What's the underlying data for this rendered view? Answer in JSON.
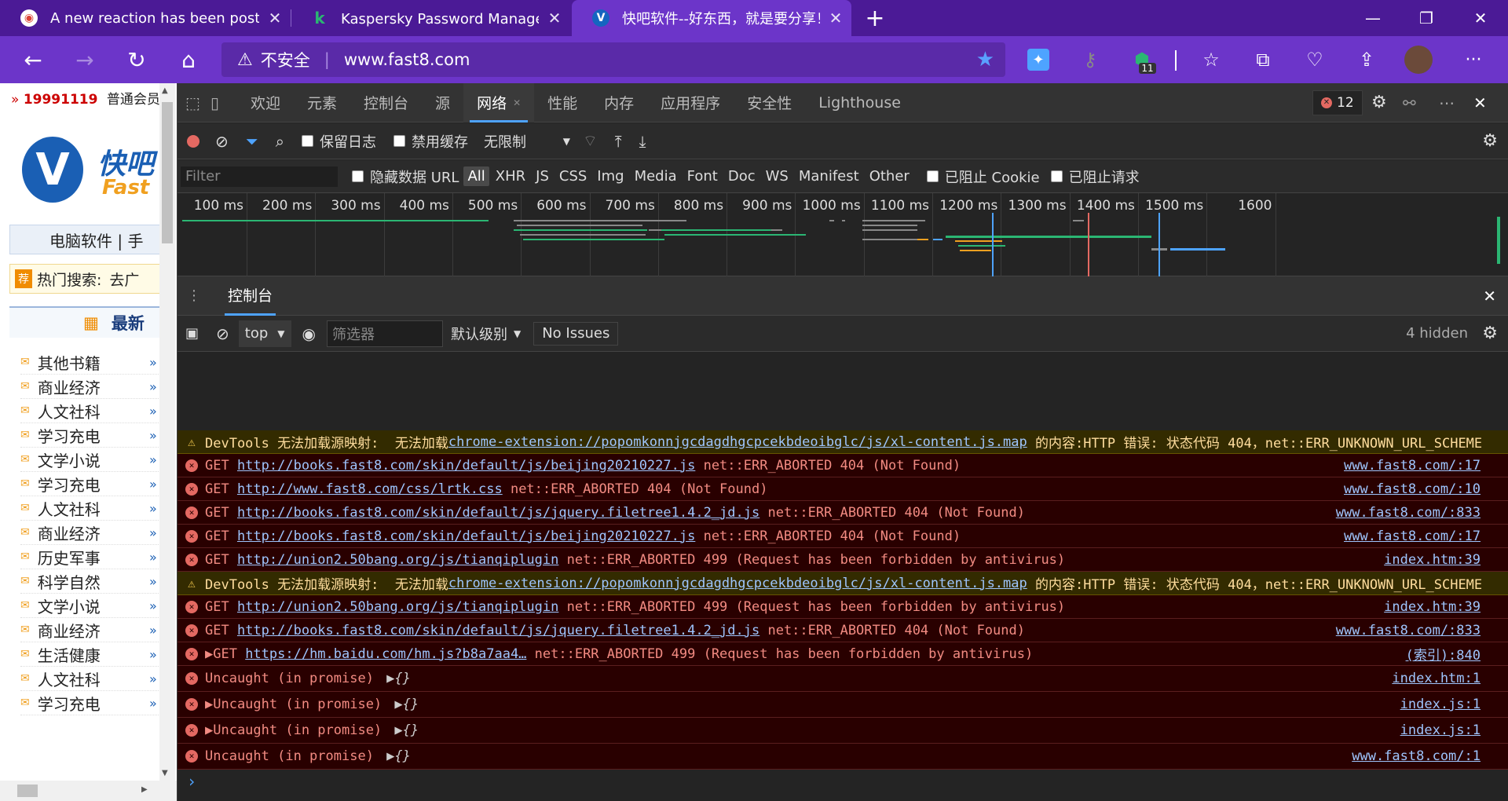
{
  "tabs": [
    {
      "title": "A new reaction has been posted",
      "icon": "chrome-icon"
    },
    {
      "title": "Kaspersky Password Manager自动",
      "icon": "kaspersky-icon"
    },
    {
      "title": "快吧软件--好东西，就是要分享！",
      "icon": "fast8-icon"
    }
  ],
  "address": {
    "security_label": "不安全",
    "url": "www.fast8.com",
    "ext_badge": "11"
  },
  "page": {
    "user_id": "19991119",
    "user_level": "普通会员",
    "logo_text_1": "快吧",
    "logo_text_2": "Fast",
    "nav_text": "电脑软件 | 手",
    "hot_label": "热门搜索:",
    "hot_value": "去广",
    "section_title": "最新",
    "categories": [
      "其他书籍",
      "商业经济",
      "人文社科",
      "学习充电",
      "文学小说",
      "学习充电",
      "人文社科",
      "商业经济",
      "历史军事",
      "科学自然",
      "文学小说",
      "商业经济",
      "生活健康",
      "人文社科",
      "学习充电"
    ]
  },
  "devtools": {
    "tabs": [
      "欢迎",
      "元素",
      "控制台",
      "源",
      "网络",
      "性能",
      "内存",
      "应用程序",
      "安全性",
      "Lighthouse"
    ],
    "selected_tab": "网络",
    "error_count": "12",
    "network": {
      "preserve_log": "保留日志",
      "disable_cache": "禁用缓存",
      "throttle": "无限制",
      "filter_placeholder": "Filter",
      "hide_data_urls": "隐藏数据 URL",
      "type_filters": [
        "All",
        "XHR",
        "JS",
        "CSS",
        "Img",
        "Media",
        "Font",
        "Doc",
        "WS",
        "Manifest",
        "Other"
      ],
      "blocked_cookies": "已阻止 Cookie",
      "blocked_requests": "已阻止请求",
      "ticks": [
        "100 ms",
        "200 ms",
        "300 ms",
        "400 ms",
        "500 ms",
        "600 ms",
        "700 ms",
        "800 ms",
        "900 ms",
        "1000 ms",
        "1100 ms",
        "1200 ms",
        "1300 ms",
        "1400 ms",
        "1500 ms",
        "1600"
      ]
    },
    "drawer_tab": "控制台",
    "console": {
      "context": "top",
      "filter_placeholder": "筛选器",
      "level": "默认级别",
      "issues": "No Issues",
      "hidden": "4 hidden",
      "messages": [
        {
          "type": "warn",
          "pre": "DevTools 无法加载源映射:  无法加载",
          "link": "chrome-extension://popomkonnjgcdagdhgcpcekbdeoibglc/js/xl-content.js.map",
          "post": " 的内容:HTTP 错误: 状态代码 404，net::ERR_UNKNOWN_URL_SCHEME",
          "src": ""
        },
        {
          "type": "error",
          "pre": "GET ",
          "link": "http://books.fast8.com/skin/default/js/beijing20210227.js",
          "post": " net::ERR_ABORTED 404 (Not Found)",
          "src": "www.fast8.com/:17"
        },
        {
          "type": "error",
          "pre": "GET ",
          "link": "http://www.fast8.com/css/lrtk.css",
          "post": " net::ERR_ABORTED 404 (Not Found)",
          "src": "www.fast8.com/:10"
        },
        {
          "type": "error",
          "pre": "GET ",
          "link": "http://books.fast8.com/skin/default/js/jquery.filetree1.4.2_jd.js",
          "post": " net::ERR_ABORTED 404 (Not Found)",
          "src": "www.fast8.com/:833"
        },
        {
          "type": "error",
          "pre": "GET ",
          "link": "http://books.fast8.com/skin/default/js/beijing20210227.js",
          "post": " net::ERR_ABORTED 404 (Not Found)",
          "src": "www.fast8.com/:17"
        },
        {
          "type": "error",
          "pre": "GET ",
          "link": "http://union2.50bang.org/js/tianqiplugin",
          "post": " net::ERR_ABORTED 499 (Request has been forbidden by antivirus)",
          "src": "index.htm:39"
        },
        {
          "type": "warn",
          "pre": "DevTools 无法加载源映射:  无法加载",
          "link": "chrome-extension://popomkonnjgcdagdhgcpcekbdeoibglc/js/xl-content.js.map",
          "post": " 的内容:HTTP 错误: 状态代码 404，net::ERR_UNKNOWN_URL_SCHEME",
          "src": ""
        },
        {
          "type": "error",
          "pre": "GET ",
          "link": "http://union2.50bang.org/js/tianqiplugin",
          "post": " net::ERR_ABORTED 499 (Request has been forbidden by antivirus)",
          "src": "index.htm:39"
        },
        {
          "type": "error",
          "pre": "GET ",
          "link": "http://books.fast8.com/skin/default/js/jquery.filetree1.4.2_jd.js",
          "post": " net::ERR_ABORTED 404 (Not Found)",
          "src": "www.fast8.com/:833"
        },
        {
          "type": "error",
          "pre": "▶GET ",
          "link": "https://hm.baidu.com/hm.js?b8a7aa4…",
          "post": " net::ERR_ABORTED 499 (Request has been forbidden by antivirus)",
          "src": "(索引):840"
        },
        {
          "type": "error",
          "pre": "Uncaught (in promise) ",
          "link": "",
          "post": "▶{}",
          "src": "index.htm:1"
        },
        {
          "type": "error",
          "pre": "▶Uncaught (in promise) ",
          "link": "",
          "post": "▶{}",
          "src": "index.js:1"
        },
        {
          "type": "error",
          "pre": "▶Uncaught (in promise) ",
          "link": "",
          "post": "▶{}",
          "src": "index.js:1"
        },
        {
          "type": "error",
          "pre": "Uncaught (in promise) ",
          "link": "",
          "post": "▶{}",
          "src": "www.fast8.com/:1"
        }
      ],
      "prompt": "›"
    }
  }
}
